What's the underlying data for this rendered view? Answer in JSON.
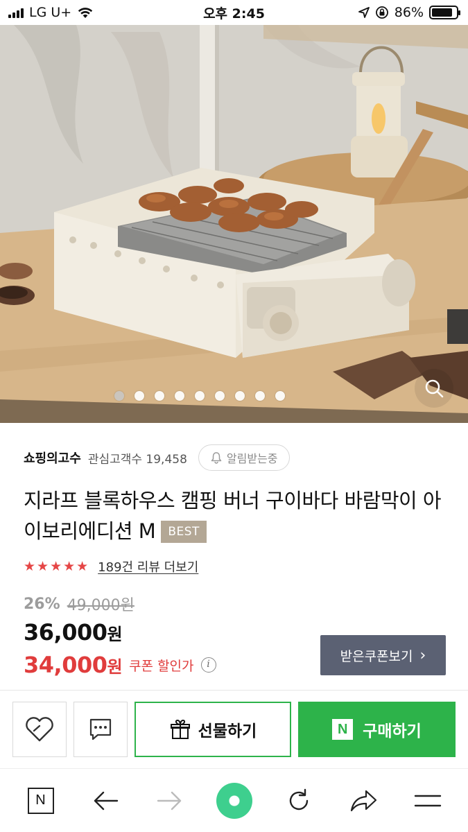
{
  "status_bar": {
    "carrier": "LG U+",
    "time": "오후 2:45",
    "battery_percent": "86%",
    "battery_level": 0.86,
    "icons": [
      "signal-icon",
      "wifi-icon",
      "location-icon",
      "rotation-lock-icon",
      "battery-icon"
    ]
  },
  "hero": {
    "image_count": 9,
    "active_index": 0,
    "zoom_icon": "magnifier-icon"
  },
  "store": {
    "name": "쇼핑의고수",
    "follower_label": "관심고객수 19,458",
    "notify_label": "알림받는중",
    "notify_icon": "bell-icon"
  },
  "product": {
    "title": "지라프 블록하우스 캠핑 버너 구이바다 바람막이 아이보리에디션 M",
    "badge": "BEST"
  },
  "rating": {
    "stars": "★★★★★",
    "star_count": 5,
    "review_link": "189건 리뷰 더보기"
  },
  "price": {
    "discount_rate": "26%",
    "original": "49,000원",
    "sale_amount": "36,000",
    "sale_unit": "원",
    "coupon_amount": "34,000",
    "coupon_unit": "원",
    "coupon_label": "쿠폰 할인가",
    "info_symbol": "i",
    "coupon_button": "받은쿠폰보기",
    "coupon_button_arrow": "›"
  },
  "actions": {
    "gift_label": "선물하기",
    "buy_label": "구매하기",
    "buy_logo": "N"
  },
  "browser": {
    "home_logo": "N",
    "icons": [
      "n-home-icon",
      "back-arrow-icon",
      "forward-arrow-icon",
      "green-ball-icon",
      "refresh-icon",
      "share-icon",
      "menu-icon"
    ]
  },
  "colors": {
    "accent_green": "#2db34a",
    "price_red": "#e03c3c",
    "star_red": "#e54646",
    "coupon_button_bg": "#5b6173",
    "badge_bg": "#b3a795"
  }
}
